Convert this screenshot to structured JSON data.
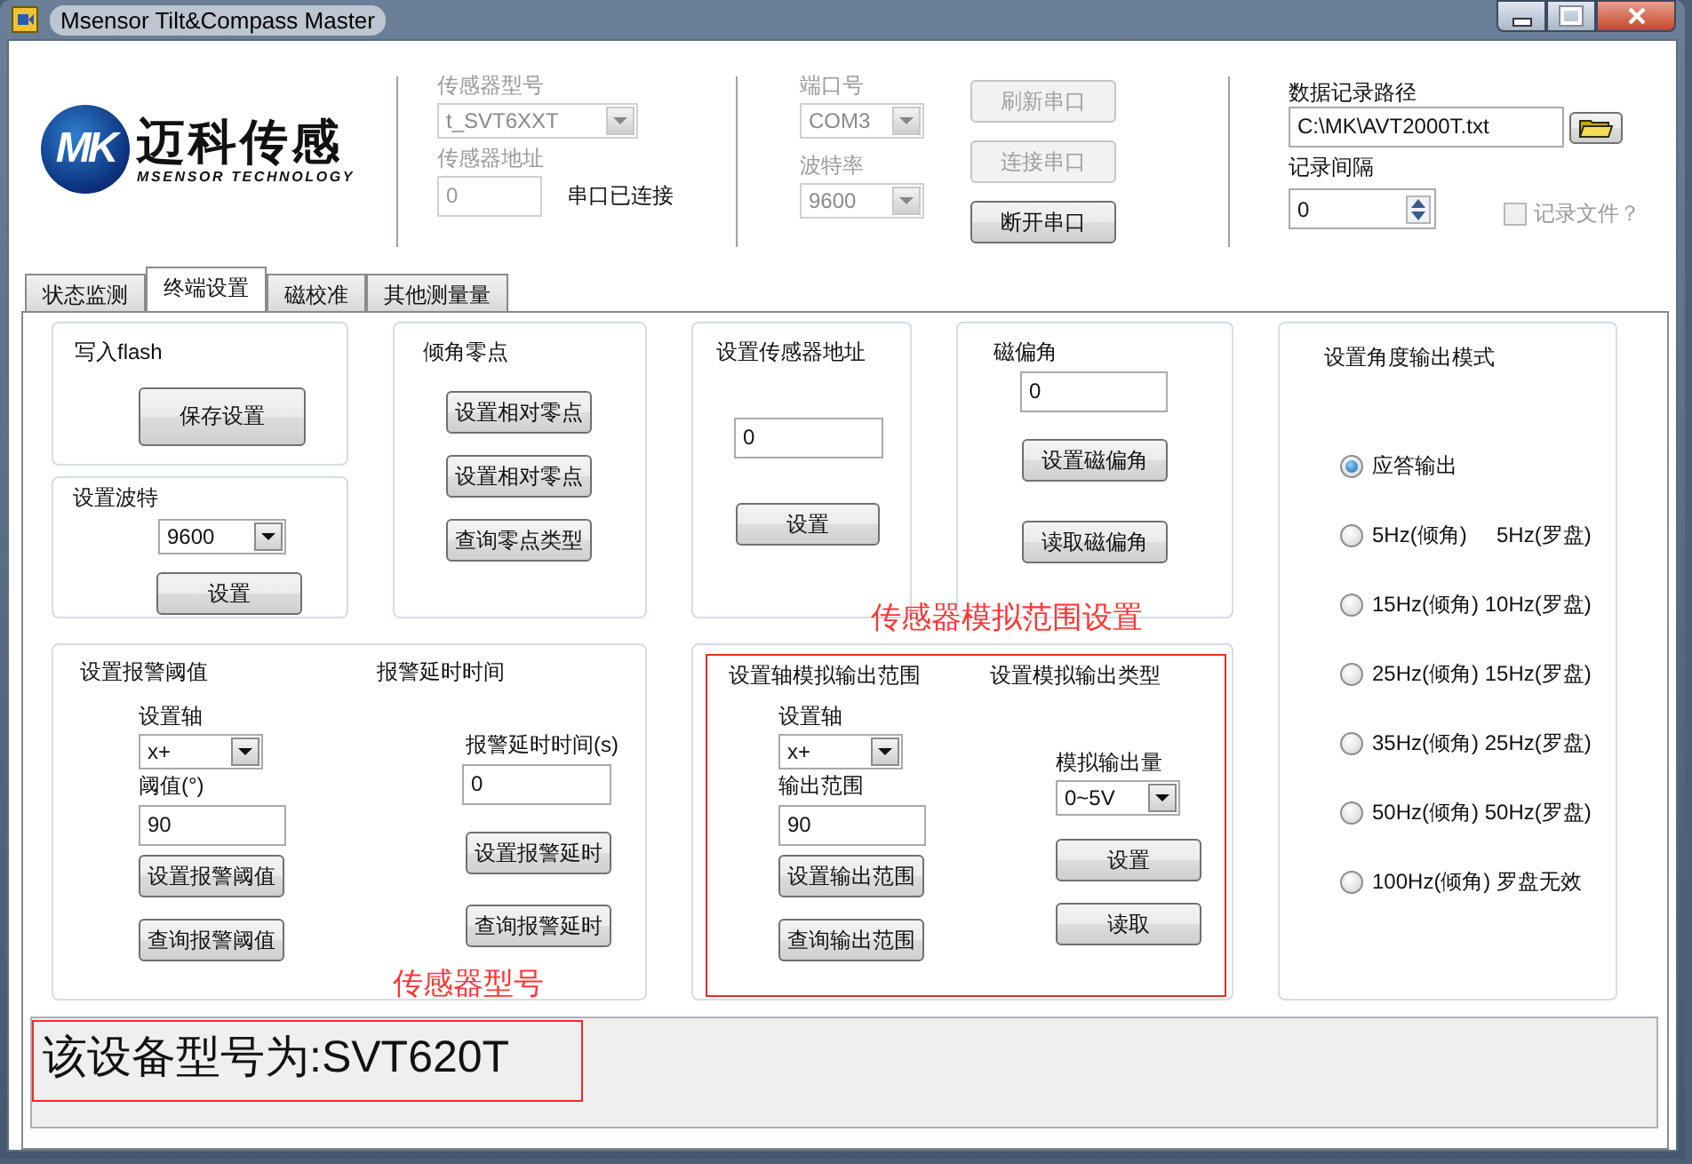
{
  "window": {
    "title": "Msensor Tilt&Compass Master"
  },
  "logo": {
    "mark": "MK",
    "name": "迈科传感",
    "tagline": "MSENSOR TECHNOLOGY"
  },
  "sensor": {
    "model_label": "传感器型号",
    "model": {
      "value": "t_SVT6XXT",
      "disabled": true
    },
    "address_label": "传感器地址",
    "address": {
      "value": "0",
      "disabled": true
    },
    "status": "串口已连接"
  },
  "port": {
    "port_label": "端口号",
    "port": {
      "value": "COM3",
      "disabled": true
    },
    "baud_label": "波特率",
    "baud": {
      "value": "9600",
      "disabled": true
    },
    "buttons": [
      {
        "label": "刷新串口",
        "disabled": true
      },
      {
        "label": "连接串口",
        "disabled": true
      },
      {
        "label": "断开串口",
        "disabled": false
      }
    ]
  },
  "logging": {
    "path_label": "数据记录路径",
    "path": "C:\\MK\\AVT2000T.txt",
    "interval_label": "记录间隔",
    "interval": "0",
    "record_file": {
      "label": "记录文件？",
      "checked": false,
      "disabled": true
    }
  },
  "tabs": [
    {
      "label": "状态监测",
      "selected": false
    },
    {
      "label": "终端设置",
      "selected": true
    },
    {
      "label": "磁校准",
      "selected": false
    },
    {
      "label": "其他测量量",
      "selected": false
    }
  ],
  "flash": {
    "title": "写入flash",
    "button": "保存设置"
  },
  "baud_panel": {
    "title": "设置波特",
    "value": "9600",
    "button": "设置"
  },
  "zero": {
    "title": "倾角零点",
    "buttons": [
      "设置相对零点",
      "设置相对零点",
      "查询零点类型"
    ]
  },
  "address_panel": {
    "title": "设置传感器地址",
    "value": "0",
    "button": "设置"
  },
  "declination": {
    "title": "磁偏角",
    "value": "0",
    "buttons": [
      "设置磁偏角",
      "读取磁偏角"
    ]
  },
  "output_mode": {
    "title": "设置角度输出模式",
    "options": [
      {
        "label": "应答输出",
        "selected": true
      },
      {
        "label": "5Hz(倾角)     5Hz(罗盘)",
        "selected": false
      },
      {
        "label": "15Hz(倾角) 10Hz(罗盘)",
        "selected": false
      },
      {
        "label": "25Hz(倾角) 15Hz(罗盘)",
        "selected": false
      },
      {
        "label": "35Hz(倾角) 25Hz(罗盘)",
        "selected": false
      },
      {
        "label": "50Hz(倾角) 50Hz(罗盘)",
        "selected": false
      },
      {
        "label": "100Hz(倾角) 罗盘无效",
        "selected": false
      }
    ]
  },
  "alarm": {
    "title": "设置报警阈值",
    "axis_label": "设置轴",
    "axis": "x+",
    "threshold_label": "阈值(°)",
    "threshold": "90",
    "buttons": [
      "设置报警阈值",
      "查询报警阈值"
    ],
    "delay_title": "报警延时时间",
    "delay_label": "报警延时时间(s)",
    "delay": "0",
    "delay_buttons": [
      "设置报警延时",
      "查询报警延时"
    ]
  },
  "analog": {
    "title": "设置轴模拟输出范围",
    "axis_label": "设置轴",
    "axis": "x+",
    "range_label": "输出范围",
    "range": "90",
    "buttons": [
      "设置输出范围",
      "查询输出范围"
    ],
    "type_title": "设置模拟输出类型",
    "output_label": "模拟输出量",
    "output": "0~5V",
    "type_buttons": [
      "设置",
      "读取"
    ]
  },
  "annotations": [
    {
      "text": "传感器模拟范围设置"
    },
    {
      "text": "传感器型号"
    }
  ],
  "status_panel": {
    "message": "该设备型号为:SVT620T"
  }
}
